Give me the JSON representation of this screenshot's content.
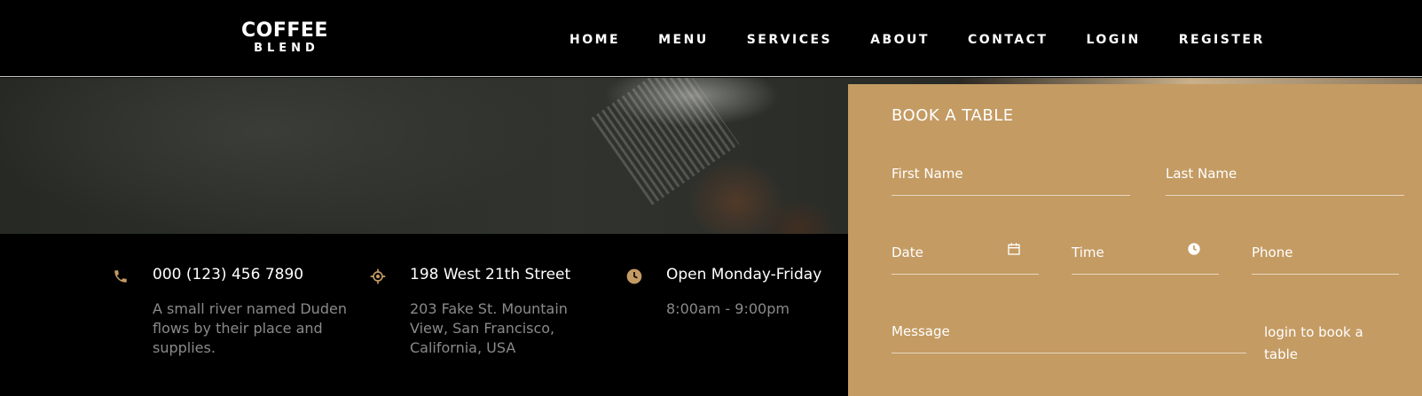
{
  "brand": {
    "line1": "COFFEE",
    "line2": "BLEND"
  },
  "nav": {
    "items": [
      "HOME",
      "MENU",
      "SERVICES",
      "ABOUT",
      "CONTACT",
      "LOGIN",
      "REGISTER"
    ]
  },
  "info": {
    "phone": {
      "icon": "phone-icon",
      "title": "000 (123) 456 7890",
      "text": "A small river named Duden flows by their place and supplies."
    },
    "address": {
      "icon": "location-icon",
      "title": "198 West 21th Street",
      "text": "203 Fake St. Mountain View, San Francisco, California, USA"
    },
    "hours": {
      "icon": "clock-icon",
      "title": "Open Monday-Friday",
      "text": "8:00am - 9:00pm"
    }
  },
  "booking": {
    "title": "BOOK A TABLE",
    "first_name": "First Name",
    "last_name": "Last Name",
    "date": "Date",
    "time": "Time",
    "phone": "Phone",
    "message": "Message",
    "login_note": "login to book a table"
  },
  "colors": {
    "accent": "#c49b63",
    "background": "#000000",
    "muted_text": "#8a8a8a"
  }
}
